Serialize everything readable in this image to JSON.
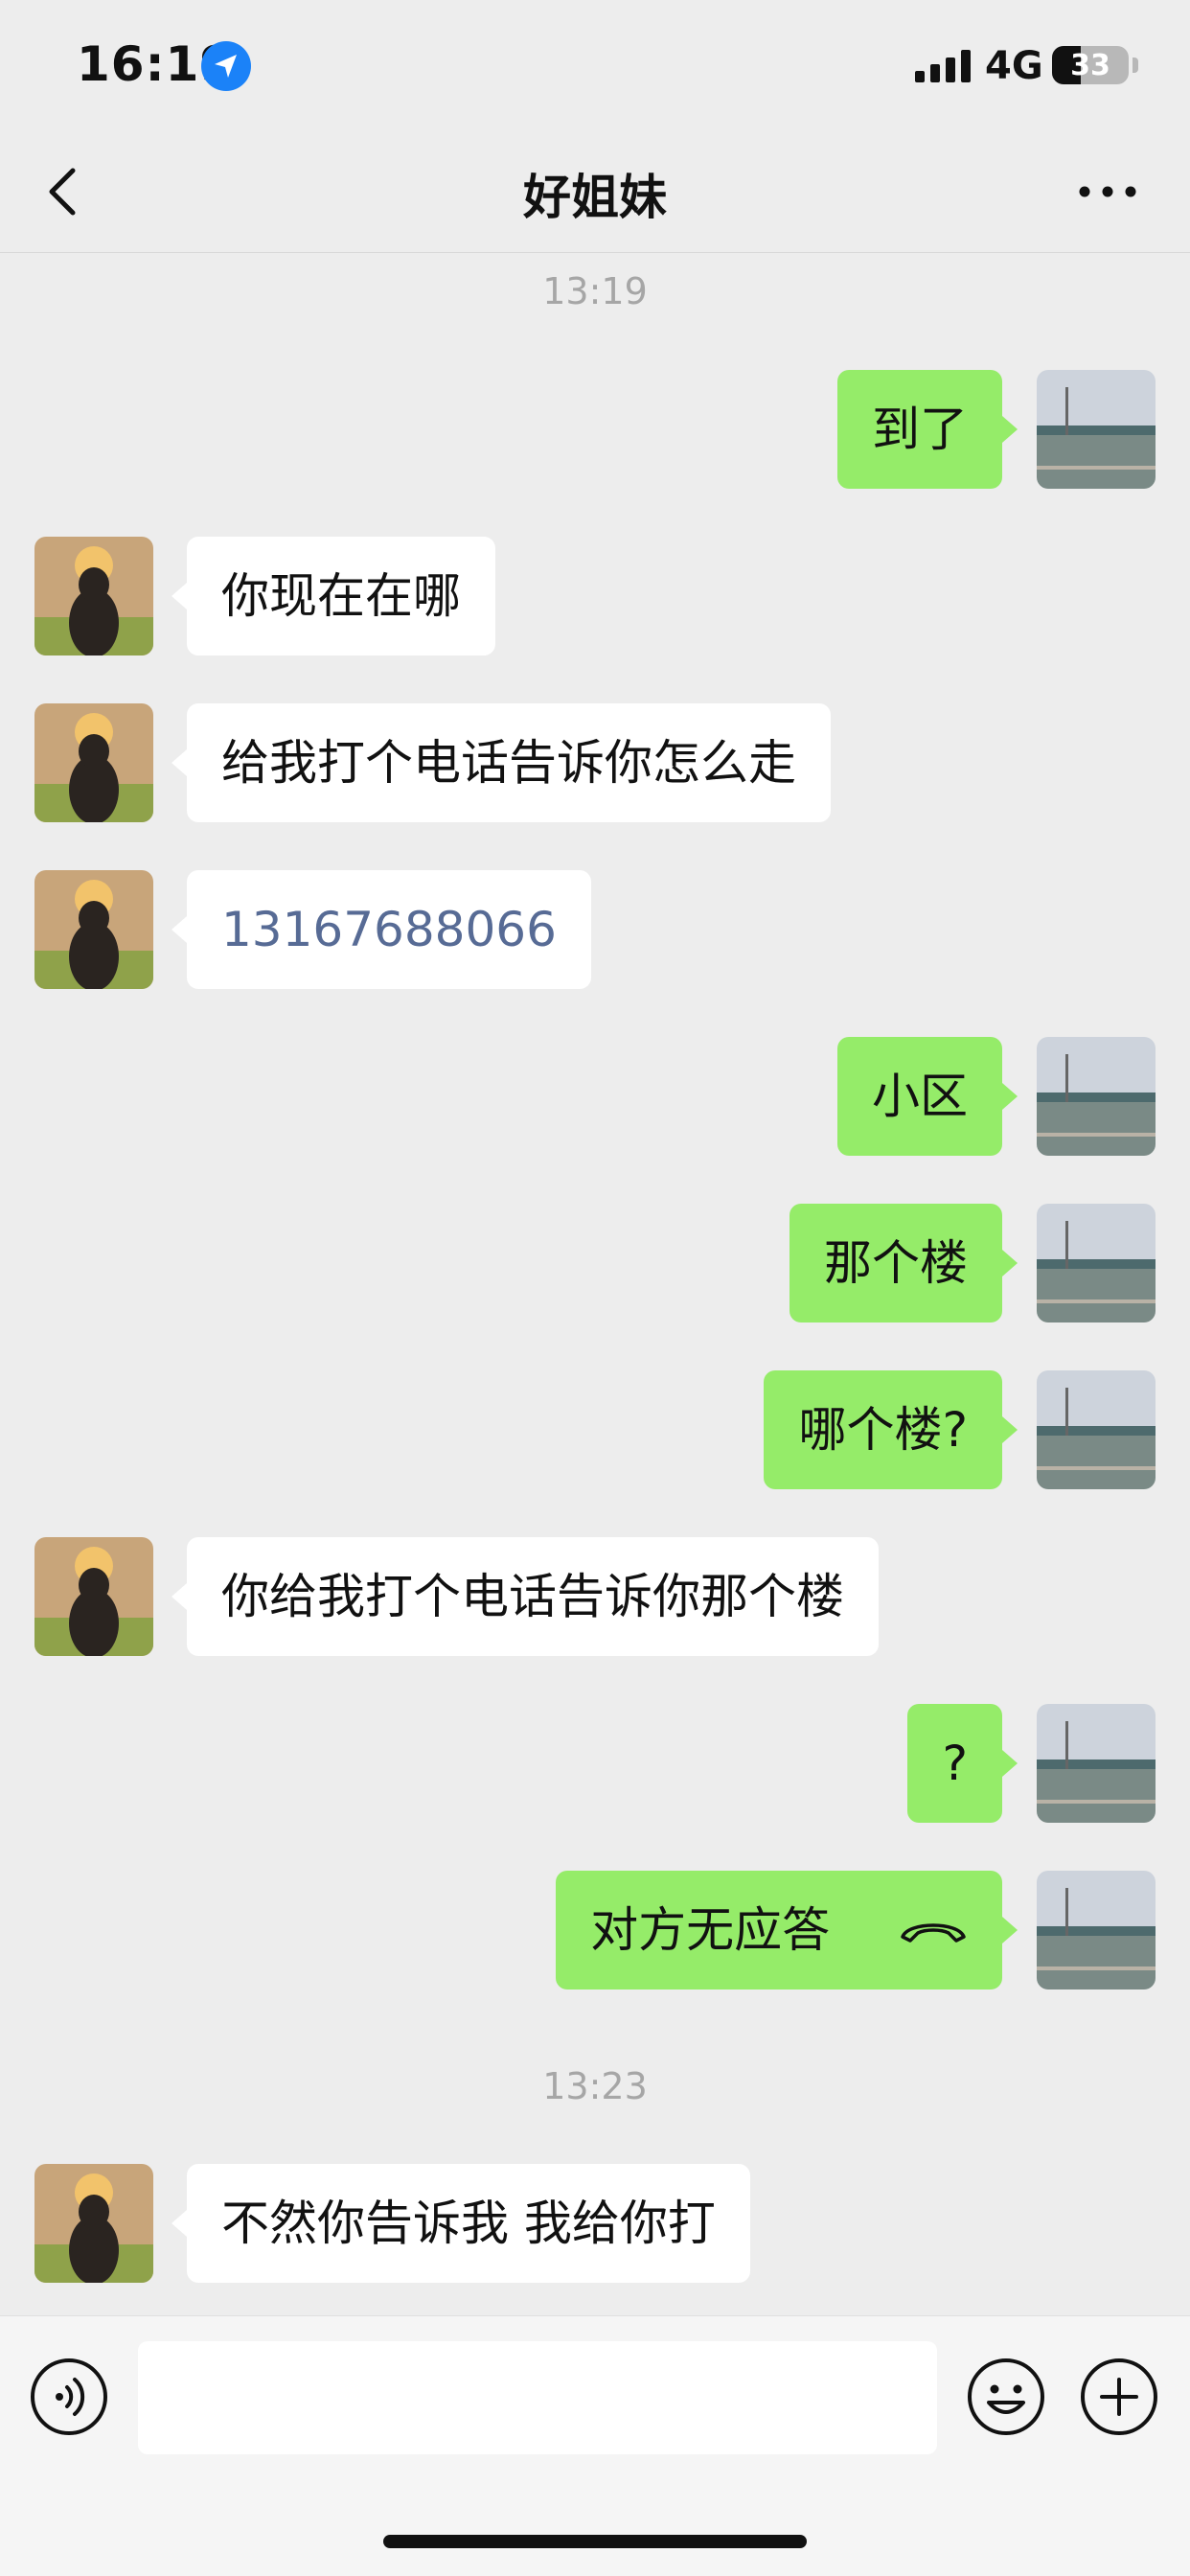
{
  "status_bar": {
    "time": "16:19",
    "network": "4G",
    "battery": "33"
  },
  "nav": {
    "title": "好姐妹"
  },
  "timestamps": [
    "13:19",
    "13:23"
  ],
  "messages": [
    {
      "side": "out",
      "text": "到了"
    },
    {
      "side": "in",
      "text": "你现在在哪"
    },
    {
      "side": "in",
      "text": "给我打个电话告诉你怎么走"
    },
    {
      "side": "in",
      "text": "13167688066",
      "is_link": true
    },
    {
      "side": "out",
      "text": "小区"
    },
    {
      "side": "out",
      "text": "那个楼"
    },
    {
      "side": "out",
      "text": "哪个楼?"
    },
    {
      "side": "in",
      "text": "你给我打个电话告诉你那个楼"
    },
    {
      "side": "out",
      "text": "?"
    },
    {
      "side": "out",
      "text": "对方无应答",
      "icon": "phone-hangup-icon"
    },
    {
      "side": "in",
      "text": "不然你告诉我 我给你打"
    }
  ],
  "input": {
    "placeholder": ""
  },
  "colors": {
    "outgoing_bubble": "#95ec69",
    "incoming_bubble": "#ffffff",
    "link": "#576b95",
    "background": "#ededed"
  }
}
